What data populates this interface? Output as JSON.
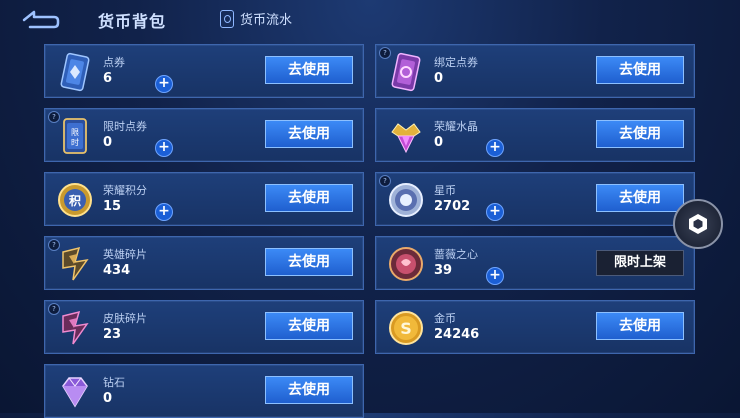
{
  "header": {
    "title": "货币背包",
    "flow_label": "货币流水"
  },
  "items": [
    {
      "name": "点券",
      "count": "6",
      "action": "去使用",
      "icon": "coupon-icon",
      "has_plus": true
    },
    {
      "name": "绑定点券",
      "count": "0",
      "action": "去使用",
      "icon": "bound-coupon-icon",
      "has_plus": false
    },
    {
      "name": "限时点券",
      "count": "0",
      "action": "去使用",
      "icon": "limited-coupon-icon",
      "has_plus": true
    },
    {
      "name": "荣耀水晶",
      "count": "0",
      "action": "去使用",
      "icon": "glory-crystal-icon",
      "has_plus": true
    },
    {
      "name": "荣耀积分",
      "count": "15",
      "action": "去使用",
      "icon": "glory-points-icon",
      "has_plus": true
    },
    {
      "name": "星币",
      "count": "2702",
      "action": "去使用",
      "icon": "star-coin-icon",
      "has_plus": true
    },
    {
      "name": "英雄碎片",
      "count": "434",
      "action": "去使用",
      "icon": "hero-shard-icon",
      "has_plus": false
    },
    {
      "name": "蔷薇之心",
      "count": "39",
      "action": "限时上架",
      "icon": "rose-heart-icon",
      "has_plus": true
    },
    {
      "name": "皮肤碎片",
      "count": "23",
      "action": "去使用",
      "icon": "skin-shard-icon",
      "has_plus": false
    },
    {
      "name": "金币",
      "count": "24246",
      "action": "去使用",
      "icon": "gold-coin-icon",
      "has_plus": false
    },
    {
      "name": "钻石",
      "count": "0",
      "action": "去使用",
      "icon": "diamond-icon",
      "has_plus": false
    }
  ],
  "colors": {
    "accent": "#2f76ea",
    "panel": "#1b3a70",
    "border": "#3e66ad"
  }
}
